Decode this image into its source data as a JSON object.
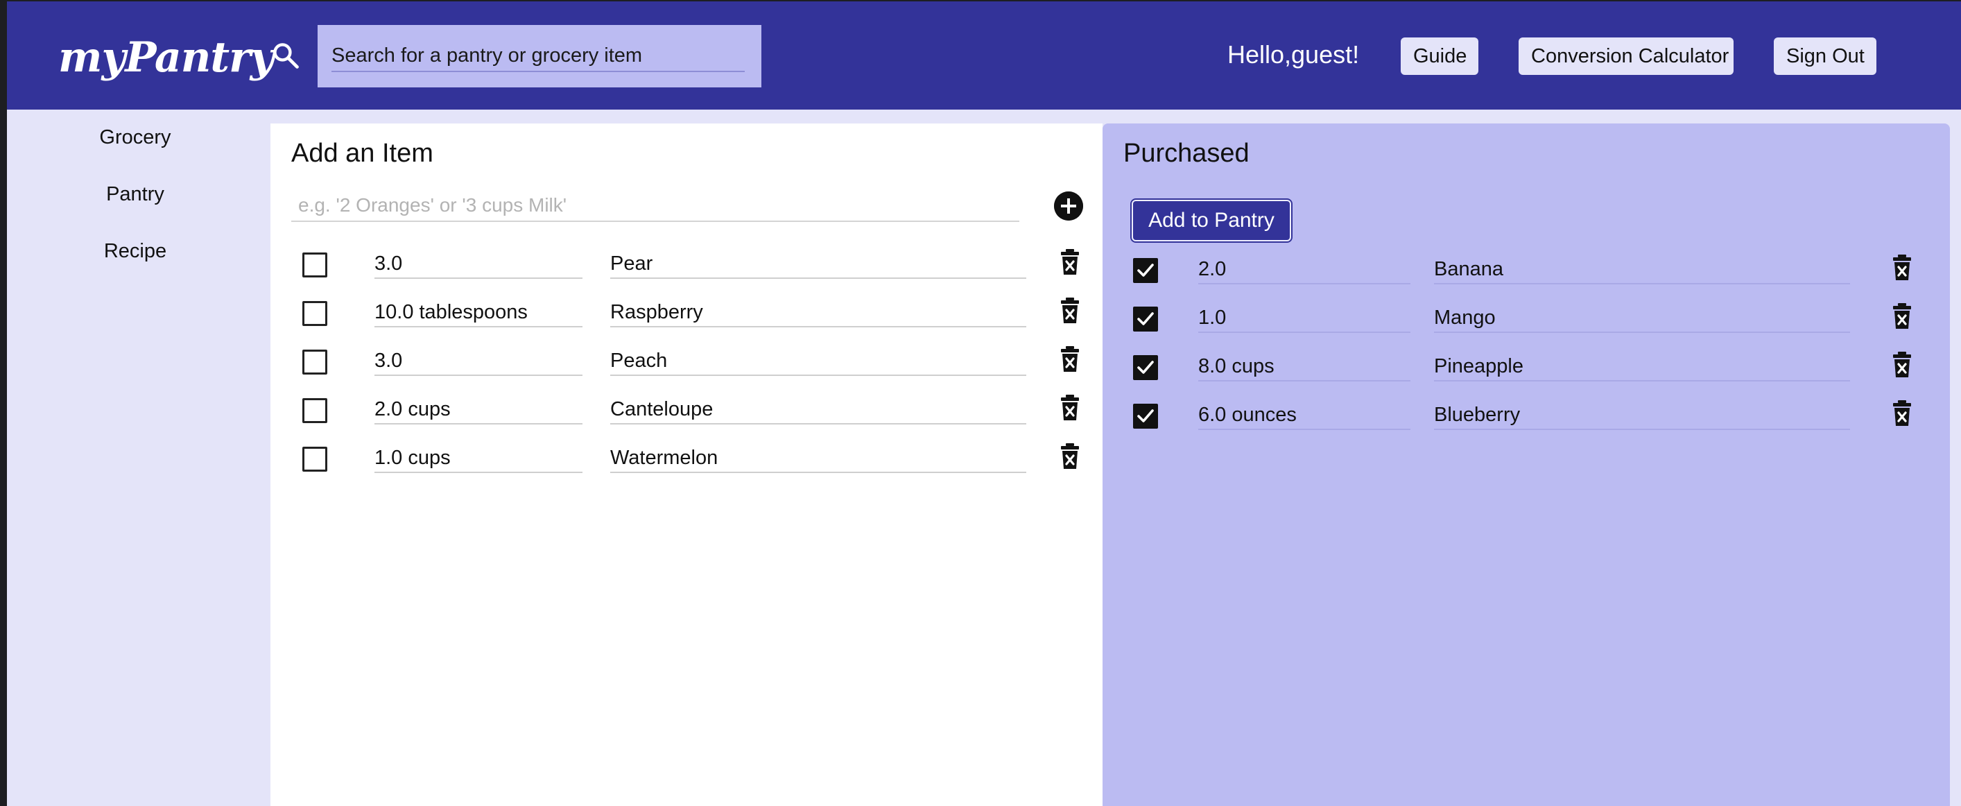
{
  "header": {
    "logo": "myPantry",
    "search_placeholder": "Search for a pantry or grocery item",
    "greeting": "Hello,guest!",
    "guide_label": "Guide",
    "conversion_label": "Conversion Calculator",
    "signout_label": "Sign Out"
  },
  "sidebar": {
    "items": [
      {
        "label": "Grocery"
      },
      {
        "label": "Pantry"
      },
      {
        "label": "Recipe"
      }
    ]
  },
  "grocery": {
    "title": "Add an Item",
    "input_placeholder": "e.g. '2 Oranges' or '3 cups Milk'",
    "items": [
      {
        "qty": "3.0",
        "name": "Pear",
        "checked": false
      },
      {
        "qty": "10.0 tablespoons",
        "name": "Raspberry",
        "checked": false
      },
      {
        "qty": "3.0",
        "name": "Peach",
        "checked": false
      },
      {
        "qty": "2.0 cups",
        "name": "Canteloupe",
        "checked": false
      },
      {
        "qty": "1.0 cups",
        "name": "Watermelon",
        "checked": false
      }
    ]
  },
  "purchased": {
    "title": "Purchased",
    "add_to_pantry_label": "Add to Pantry",
    "items": [
      {
        "qty": "2.0",
        "name": "Banana",
        "checked": true
      },
      {
        "qty": "1.0",
        "name": "Mango",
        "checked": true
      },
      {
        "qty": "8.0 cups",
        "name": "Pineapple",
        "checked": true
      },
      {
        "qty": "6.0 ounces",
        "name": "Blueberry",
        "checked": true
      }
    ]
  },
  "colors": {
    "header_bg": "#333399",
    "app_bg": "#e4e4f9",
    "purchased_bg": "#bbbbf2",
    "search_bg": "#bbbbf2"
  },
  "icons": {
    "search": "search-icon",
    "add": "plus-circle-icon",
    "delete": "trash-x-icon",
    "check": "checkmark-icon"
  }
}
